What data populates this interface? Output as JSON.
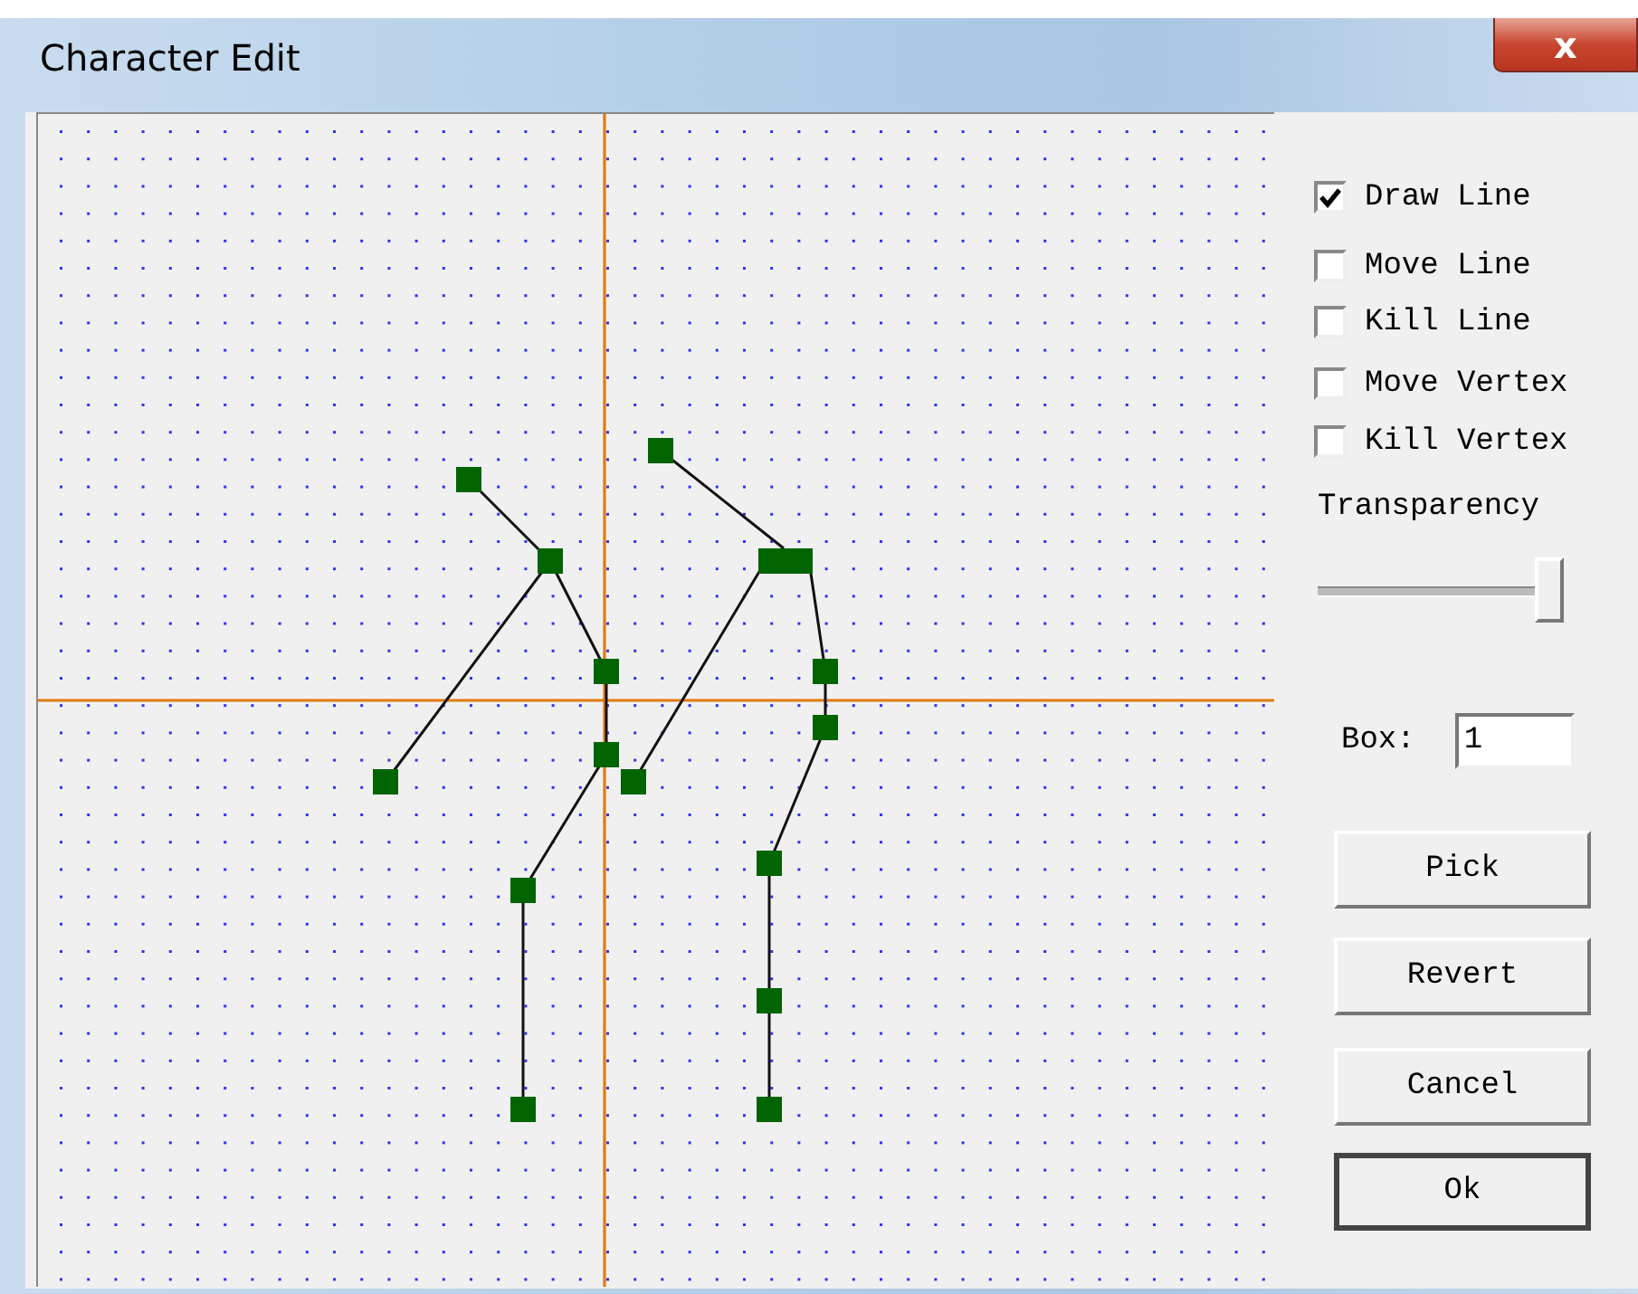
{
  "window": {
    "title": "Character Edit",
    "close": "x"
  },
  "options": [
    {
      "label": "Draw Line",
      "checked": true
    },
    {
      "label": "Move Line",
      "checked": false
    },
    {
      "label": "Kill Line",
      "checked": false
    },
    {
      "label": "Move Vertex",
      "checked": false
    },
    {
      "label": "Kill Vertex",
      "checked": false
    }
  ],
  "transparency": {
    "label": "Transparency",
    "level": 0.95
  },
  "box": {
    "label": "Box:",
    "value": "1"
  },
  "buttons": [
    {
      "label": "Pick",
      "default": false
    },
    {
      "label": "Revert",
      "default": false
    },
    {
      "label": "Cancel",
      "default": false
    },
    {
      "label": "Ok",
      "default": true
    }
  ]
}
